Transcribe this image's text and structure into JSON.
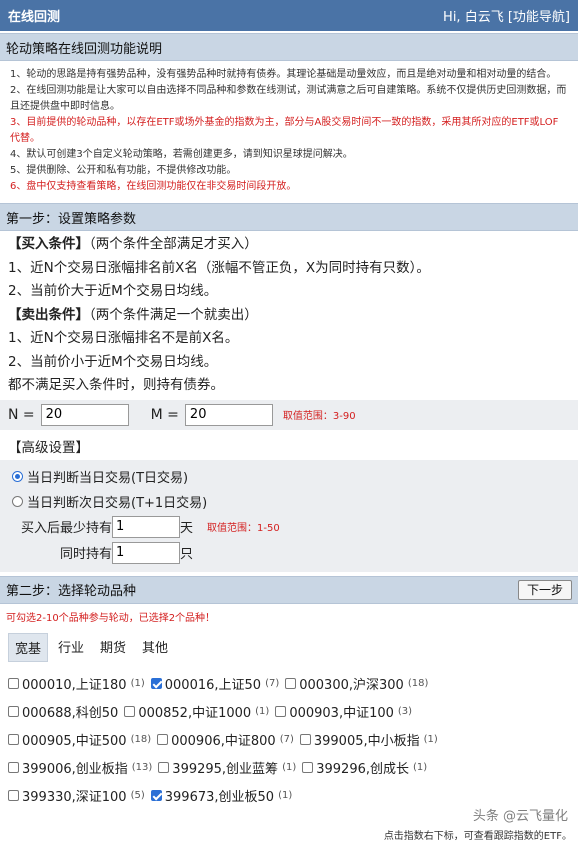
{
  "header": {
    "title": "在线回测",
    "greeting": "Hi, 白云飞",
    "nav_link": "[功能导航]"
  },
  "intro": {
    "title": "轮动策略在线回测功能说明",
    "notes": [
      "1、轮动的思路是持有强势品种，没有强势品种时就持有债券。其理论基础是动量效应，而且是绝对动量和相对动量的结合。",
      "2、在线回测功能是让大家可以自由选择不同品种和参数在线测试，测试满意之后可自建策略。系统不仅提供历史回测数据，而且还提供盘中即时信息。",
      "3、目前提供的轮动品种，以存在ETF或场外基金的指数为主，部分与A股交易时间不一致的指数，采用其所对应的ETF或LOF代替。",
      "4、默认可创建3个自定义轮动策略，若需创建更多，请到知识星球提问解决。",
      "5、提供删除、公开和私有功能，不提供修改功能。",
      "6、盘中仅支持查看策略，在线回测功能仅在非交易时间段开放。"
    ]
  },
  "step1": {
    "title": "第一步：设置策略参数",
    "buy_title": "【买入条件】",
    "buy_note": "（两个条件全部满足才买入）",
    "buy_lines": [
      "1、近N个交易日涨幅排名前X名（涨幅不管正负，X为同时持有只数）。",
      "2、当前价大于近M个交易日均线。"
    ],
    "sell_title": "【卖出条件】",
    "sell_note": "（两个条件满足一个就卖出）",
    "sell_lines": [
      "1、近N个交易日涨幅排名不是前X名。",
      "2、当前价小于近M个交易日均线。"
    ],
    "bond_line": "都不满足买入条件时，则持有债券。",
    "n_label": "N =",
    "n_value": "20",
    "m_label": "M =",
    "m_value": "20",
    "nm_range": "取值范围：3-90",
    "advanced_title": "【高级设置】",
    "radio_same_day": "当日判断当日交易(T日交易)",
    "radio_next_day": "当日判断次日交易(T+1日交易)",
    "min_hold_label": "买入后最少持有",
    "min_hold_value": "1",
    "min_hold_unit": "天",
    "hold_range": "取值范围：1-50",
    "concurrent_label": "同时持有",
    "concurrent_value": "1",
    "concurrent_unit": "只"
  },
  "step2": {
    "title": "第二步：选择轮动品种",
    "next_button": "下一步",
    "hint": "可勾选2-10个品种参与轮动，已选择2个品种！",
    "tabs": [
      "宽基",
      "行业",
      "期货",
      "其他"
    ],
    "rows": [
      [
        {
          "label": "000010,上证180",
          "count": "(1)",
          "checked": false
        },
        {
          "label": "000016,上证50",
          "count": "(7)",
          "checked": true
        },
        {
          "label": "000300,沪深300",
          "count": "(18)",
          "checked": false
        }
      ],
      [
        {
          "label": "000688,科创50",
          "count": "",
          "checked": false
        },
        {
          "label": "000852,中证1000",
          "count": "(1)",
          "checked": false
        },
        {
          "label": "000903,中证100",
          "count": "(3)",
          "checked": false
        }
      ],
      [
        {
          "label": "000905,中证500",
          "count": "(18)",
          "checked": false
        },
        {
          "label": "000906,中证800",
          "count": "(7)",
          "checked": false
        },
        {
          "label": "399005,中小板指",
          "count": "(1)",
          "checked": false
        }
      ],
      [
        {
          "label": "399006,创业板指",
          "count": "(13)",
          "checked": false
        },
        {
          "label": "399295,创业蓝筹",
          "count": "(1)",
          "checked": false
        },
        {
          "label": "399296,创成长",
          "count": "(1)",
          "checked": false
        }
      ],
      [
        {
          "label": "399330,深证100",
          "count": "(5)",
          "checked": false
        },
        {
          "label": "399673,创业板50",
          "count": "(1)",
          "checked": true
        }
      ]
    ],
    "footer_tip": "点击指数右下标，可查看跟踪指数的ETF。"
  },
  "watermark": "头条 @云飞量化"
}
